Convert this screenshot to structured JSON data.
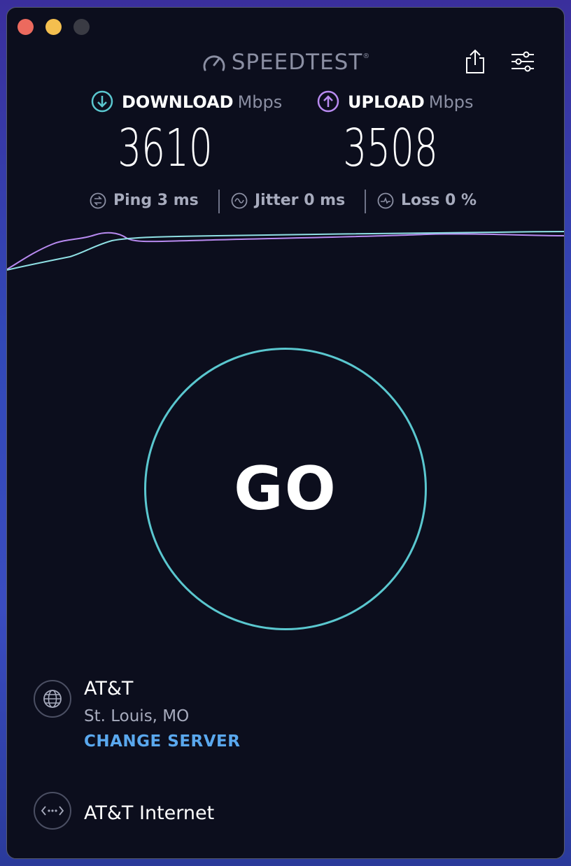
{
  "app": {
    "brand": "SPEEDTEST",
    "brand_mark": "®"
  },
  "results": {
    "download": {
      "label": "DOWNLOAD",
      "unit": "Mbps",
      "value": "3610",
      "color": "#5ac7cf"
    },
    "upload": {
      "label": "UPLOAD",
      "unit": "Mbps",
      "value": "3508",
      "color": "#b88af0"
    }
  },
  "stats": {
    "ping": {
      "label": "Ping",
      "value": "3 ms"
    },
    "jitter": {
      "label": "Jitter",
      "value": "0 ms"
    },
    "loss": {
      "label": "Loss",
      "value": "0 %"
    }
  },
  "go_button": {
    "label": "GO",
    "ring_color": "#5ac7cf"
  },
  "server": {
    "isp": "AT&T",
    "location": "St. Louis, MO",
    "change_label": "CHANGE SERVER"
  },
  "connection": {
    "name": "AT&T Internet"
  },
  "icons": [
    "speedometer-icon",
    "share-icon",
    "settings-icon",
    "download-icon",
    "upload-icon",
    "ping-icon",
    "jitter-icon",
    "loss-icon",
    "globe-icon",
    "connection-icon"
  ]
}
